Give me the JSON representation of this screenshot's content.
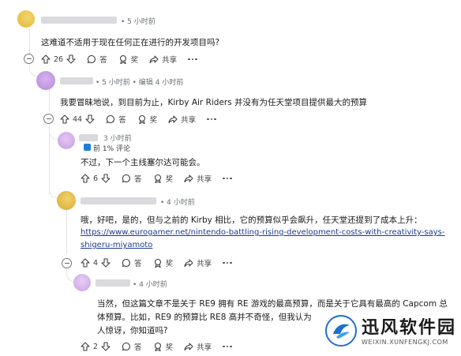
{
  "comments": [
    {
      "time": "• 5 小时前",
      "edited": "",
      "body": "这难道不适用于现在任何正在进行的开发项目吗?",
      "votes": "26",
      "reply": "答",
      "award": "奖",
      "share": "共享"
    },
    {
      "time": "• 5 小时前 • 编辑 4 小时前",
      "edited": "",
      "body": "我要冒昧地说，到目前为止，Kirby Air Riders 并没有为任天堂项目提供最大的预算",
      "votes": "44",
      "reply": "答",
      "award": "奖",
      "share": "共享"
    },
    {
      "time": "3 小时前",
      "flair": "前 1% 评论",
      "body": "不过，下一个主线塞尔达可能会。",
      "votes": "6",
      "reply": "答",
      "award": "奖",
      "share": "共享"
    },
    {
      "time": "• 4 小时前",
      "body": "哦，好吧，是的，但与之前的 Kirby 相比，它的预算似乎会飙升，任天堂还提到了成本上升：",
      "link1": "https://www.eurogamer.net/nintendo-battling-rising-development-costs-with-creativity-says-",
      "link2": "shigeru-miyamoto",
      "votes": "4",
      "reply": "答",
      "award": "奖",
      "share": "共享"
    },
    {
      "time": "• 4 小时前",
      "body1": "当然，但这篇文章不是关于 RE9 拥有 RE 游戏的最高预算，而是关于它具有最高的 Capcom 总",
      "body2": "体预算。比如，RE9 的预算比 RE8 高并不奇怪，但我认为",
      "body3": "人惊讶，你知道吗?",
      "votes": "2",
      "reply": "答",
      "award": "奖",
      "share": "共享"
    }
  ],
  "watermark": {
    "title": "迅风软件园",
    "url": "WEIXIN.XUNFENGKJ.COM"
  }
}
